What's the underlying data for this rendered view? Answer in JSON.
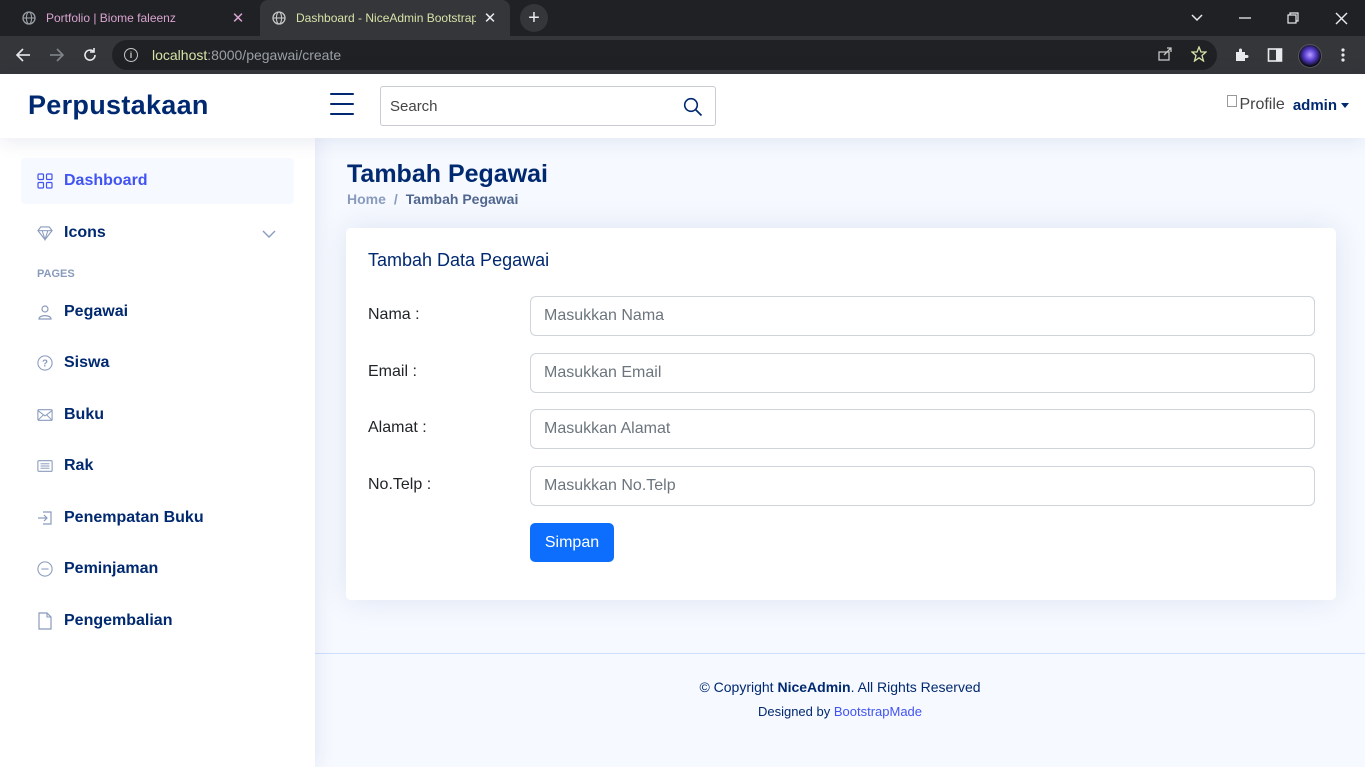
{
  "browser": {
    "tabs": [
      {
        "title": "Portfolio | Biome faleenz",
        "active": false
      },
      {
        "title": "Dashboard - NiceAdmin Bootstrap T",
        "active": true
      }
    ],
    "url_host": "localhost",
    "url_path": ":8000/pegawai/create"
  },
  "header": {
    "brand": "Perpustakaan",
    "search_placeholder": "Search",
    "profile_img_alt": "Profile",
    "profile_name": "admin"
  },
  "sidebar": {
    "items": [
      {
        "label": "Dashboard",
        "icon": "grid-icon",
        "active": true
      },
      {
        "label": "Icons",
        "icon": "gem-icon",
        "active": false
      }
    ],
    "heading": "PAGES",
    "pages": [
      {
        "label": "Pegawai",
        "icon": "person-icon"
      },
      {
        "label": "Siswa",
        "icon": "question-circle-icon"
      },
      {
        "label": "Buku",
        "icon": "envelope-icon"
      },
      {
        "label": "Rak",
        "icon": "card-list-icon"
      },
      {
        "label": "Penempatan Buku",
        "icon": "box-arrow-in-right-icon"
      },
      {
        "label": "Peminjaman",
        "icon": "dash-circle-icon"
      },
      {
        "label": "Pengembalian",
        "icon": "file-icon"
      }
    ]
  },
  "page": {
    "title": "Tambah Pegawai",
    "breadcrumb": {
      "home": "Home",
      "current": "Tambah Pegawai"
    }
  },
  "form": {
    "card_title": "Tambah Data Pegawai",
    "fields": [
      {
        "label": "Nama :",
        "placeholder": "Masukkan Nama",
        "value": ""
      },
      {
        "label": "Email :",
        "placeholder": "Masukkan Email",
        "value": ""
      },
      {
        "label": "Alamat :",
        "placeholder": "Masukkan Alamat",
        "value": ""
      },
      {
        "label": "No.Telp :",
        "placeholder": "Masukkan No.Telp",
        "value": ""
      }
    ],
    "submit_label": "Simpan"
  },
  "footer": {
    "copyright_prefix": "© Copyright ",
    "copyright_brand": "NiceAdmin",
    "copyright_suffix": ". All Rights Reserved",
    "designed_by": "Designed by ",
    "designer": "BootstrapMade"
  },
  "colors": {
    "primary": "#4154f1",
    "navy": "#012970",
    "button": "#0d6efd",
    "background": "#f6f9ff"
  }
}
